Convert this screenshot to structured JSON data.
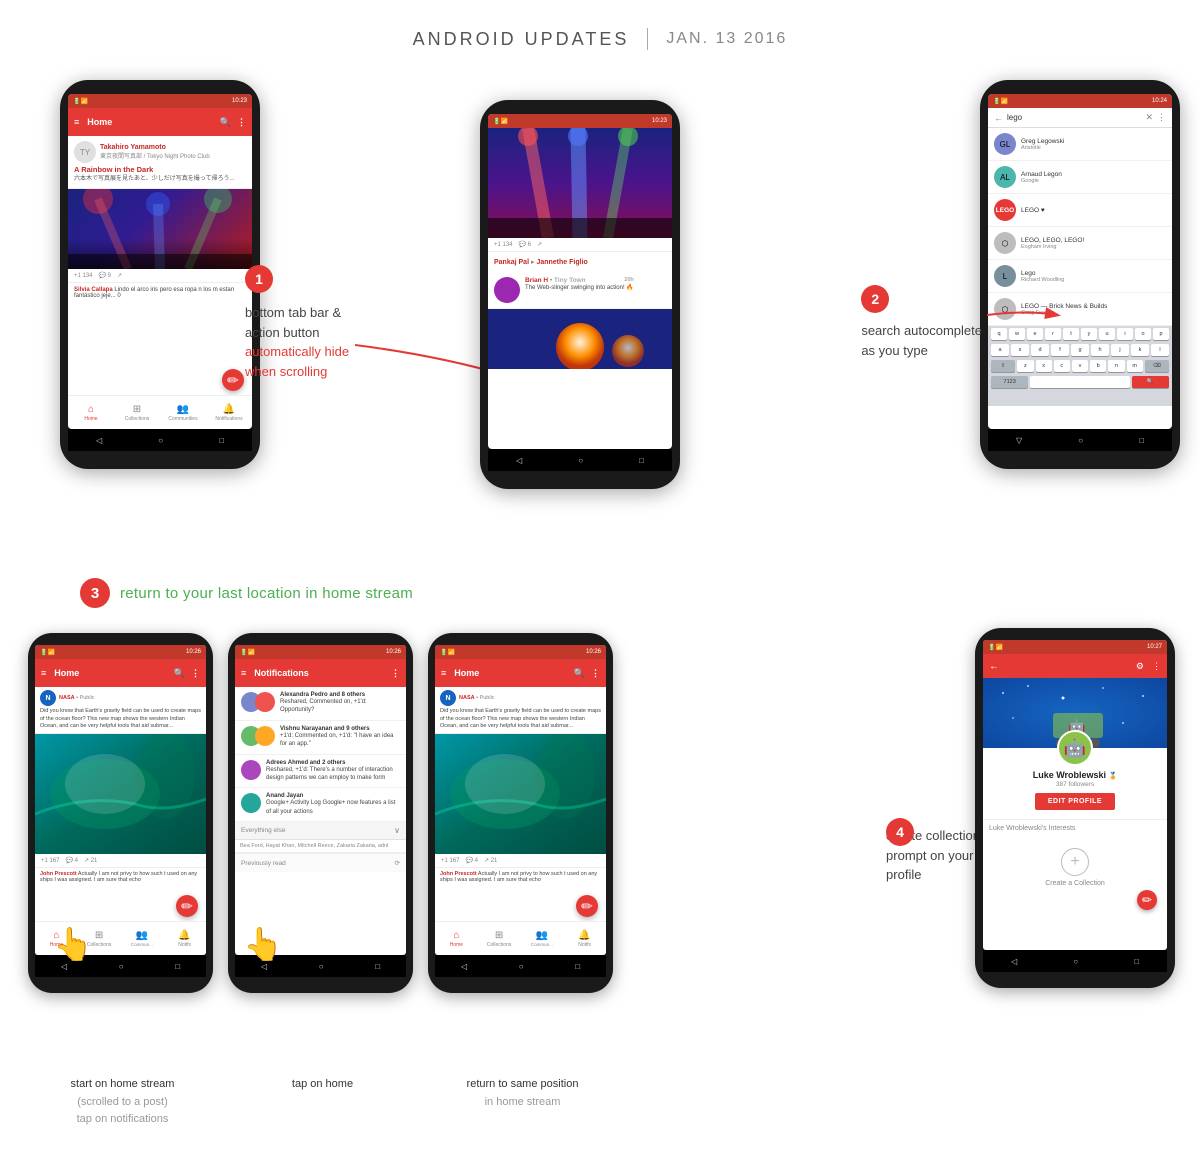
{
  "header": {
    "title": "ANDROID UPDATES",
    "divider": "|",
    "date": "JAN. 13 2016"
  },
  "annotation1": {
    "bubble": "1",
    "line1": "bottom tab bar &",
    "line2": "action button",
    "line3": "automatically hide",
    "line4": "when scrolling"
  },
  "annotation2": {
    "bubble": "2",
    "line1": "search autocomplete",
    "line2": "as you type"
  },
  "annotation3": {
    "bubble": "3",
    "text": "return to your last location in home stream"
  },
  "annotation4": {
    "bubble": "4",
    "line1": "create collection",
    "line2": "prompt on your",
    "line3": "profile"
  },
  "phone1": {
    "statusbar": "10:23",
    "appbar_title": "Home",
    "user_name": "Takahiro Yamamoto",
    "user_sub": "東京夜間写真部 / Tokyo Night Photo Club",
    "post_title": "A Rainbow in the Dark",
    "post_text": "六本木で写真展を見たあと、少しだけ写真を撮って帰ろう...",
    "commenter": "Silvia Callapa",
    "comment_text": "Lindo el arco iris pero esa ropa n los m estan fantástico jeje... 0",
    "tabs": [
      "Home",
      "Collections",
      "Communities",
      "Notifications"
    ]
  },
  "phone2": {
    "statusbar": "10:23",
    "author": "Pankaj Pal",
    "author_suffix": "Jannethe Figlio",
    "commenter": "Brian H",
    "commenter_suffix": "Tiny Town",
    "comment": "The Web-slinger swinging into action! 🔥"
  },
  "phone3": {
    "statusbar": "10:24",
    "search_query": "lego",
    "results": [
      {
        "name": "Greg Legowski",
        "sub": "Aristotle",
        "type": "person"
      },
      {
        "name": "Arnaud Legon",
        "sub": "Google",
        "type": "person"
      },
      {
        "name": "LEGO ♥",
        "sub": "",
        "type": "lego"
      },
      {
        "name": "LEGO, LEGO, LEGO!",
        "sub": "Eogham Irving",
        "type": "page"
      },
      {
        "name": "Lego",
        "sub": "Richard Woodling",
        "type": "person"
      },
      {
        "name": "LEGO — Brick News & Builds",
        "sub": "Craig Froehle",
        "type": "page"
      }
    ],
    "keyboard_rows": [
      [
        "q",
        "w",
        "e",
        "r",
        "t",
        "y",
        "u",
        "i",
        "o",
        "p"
      ],
      [
        "a",
        "s",
        "d",
        "f",
        "g",
        "h",
        "j",
        "k",
        "l"
      ],
      [
        "z",
        "x",
        "c",
        "v",
        "b",
        "n",
        "m"
      ]
    ]
  },
  "phone4": {
    "statusbar": "10:26",
    "appbar_title": "Home"
  },
  "phone5": {
    "statusbar": "10:26",
    "appbar_title": "Notifications",
    "notifications": [
      {
        "user": "Alexandra Pedro and 8 others",
        "action": "Reshared, Commented on, +1'd: Opportunity?"
      },
      {
        "user": "Vishnu Narayanan and 9 others",
        "action": "+1'd: Commented on, +1'd: \"I have an idea for an app.\""
      },
      {
        "user": "Adrees Ahmed and 2 others",
        "action": "Reshared, +1'd: There's a number of interaction design patterns we can employ to make form"
      },
      {
        "user": "Anand Jayan",
        "action": "Google+ Activity Log\nGoogle+ now features a list of all your actions"
      }
    ],
    "section_label": "Everything else",
    "section_sub": "Bea Ford, Hayat Khan, Mitchell Reece, Zakaria Zakaria, adnl",
    "prev_read": "Previously read"
  },
  "phone6": {
    "statusbar": "10:26",
    "appbar_title": "Home"
  },
  "phone_profile": {
    "statusbar": "10:27",
    "name": "Luke Wroblewski",
    "followers": "387 followers",
    "edit_label": "EDIT PROFILE",
    "interests_label": "Luke Wroblewski's Interests",
    "create_collection": "Create a Collection"
  },
  "bottom_captions": {
    "phone4_primary": "start on home stream",
    "phone4_paren": "(scrolled to a post)",
    "phone4_secondary": "tap on notifications",
    "phone5_primary": "tap on home",
    "phone6_primary": "return to same position",
    "phone6_secondary": "in home stream"
  }
}
